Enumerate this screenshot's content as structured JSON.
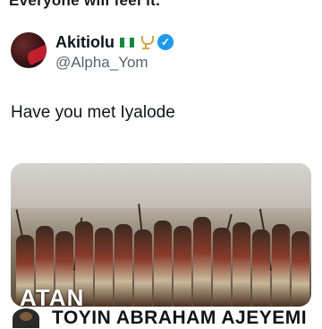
{
  "top_text": "Everyone will feel it.",
  "tweet": {
    "display_name": "Akitiolu",
    "handle": "@Alpha_Yom",
    "text": "Have you met Iyalode"
  },
  "media": {
    "caption": "ATAN"
  },
  "next_author": {
    "name": "TOYIN ABRAHAM AJEYEMI"
  },
  "colors": {
    "verified": "#1d9bf0",
    "flag_green": "#0f8a3c",
    "handle_gray": "#536471"
  }
}
